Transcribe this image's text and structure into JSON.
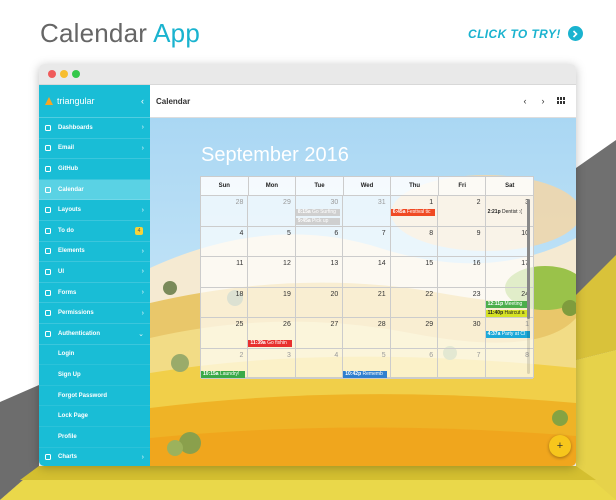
{
  "heading": {
    "part1": "Calendar",
    "part2": "App"
  },
  "cta": {
    "label": "CLICK TO TRY!"
  },
  "app": {
    "brand": "triangular",
    "toolbar_title": "Calendar"
  },
  "sidebar": {
    "items": [
      {
        "label": "Dashboards",
        "icon": "home-icon",
        "arrow": "›"
      },
      {
        "label": "Email",
        "icon": "mail-icon",
        "arrow": "›"
      },
      {
        "label": "GitHub",
        "icon": "github-icon",
        "arrow": ""
      },
      {
        "label": "Calendar",
        "icon": "calendar-icon",
        "arrow": "",
        "active": true
      },
      {
        "label": "Layouts",
        "icon": "layouts-icon",
        "arrow": "›"
      },
      {
        "label": "To do",
        "icon": "check-icon",
        "badge": "4"
      },
      {
        "label": "Elements",
        "icon": "elements-icon",
        "arrow": "›"
      },
      {
        "label": "UI",
        "icon": "ui-icon",
        "arrow": "›"
      },
      {
        "label": "Forms",
        "icon": "forms-icon",
        "arrow": "›"
      },
      {
        "label": "Permissions",
        "icon": "lock-icon",
        "arrow": "›"
      },
      {
        "label": "Authentication",
        "icon": "person-icon",
        "arrow": "⌄",
        "expanded": true
      },
      {
        "label": "Login",
        "sub": true
      },
      {
        "label": "Sign Up",
        "sub": true
      },
      {
        "label": "Forgot Password",
        "sub": true
      },
      {
        "label": "Lock Page",
        "sub": true
      },
      {
        "label": "Profile",
        "sub": true
      },
      {
        "label": "Charts",
        "icon": "chart-icon",
        "arrow": "›"
      }
    ]
  },
  "calendar": {
    "title": "September 2016",
    "weekdays": [
      "Sun",
      "Mon",
      "Tue",
      "Wed",
      "Thu",
      "Fri",
      "Sat"
    ],
    "days": [
      {
        "n": "28",
        "out": true
      },
      {
        "n": "29",
        "out": true
      },
      {
        "n": "30",
        "out": true
      },
      {
        "n": "31",
        "out": true
      },
      {
        "n": "1"
      },
      {
        "n": "2"
      },
      {
        "n": "3"
      },
      {
        "n": "4"
      },
      {
        "n": "5"
      },
      {
        "n": "6"
      },
      {
        "n": "7"
      },
      {
        "n": "8"
      },
      {
        "n": "9"
      },
      {
        "n": "10"
      },
      {
        "n": "11"
      },
      {
        "n": "12"
      },
      {
        "n": "13"
      },
      {
        "n": "14"
      },
      {
        "n": "15"
      },
      {
        "n": "16"
      },
      {
        "n": "17"
      },
      {
        "n": "18"
      },
      {
        "n": "19"
      },
      {
        "n": "20"
      },
      {
        "n": "21"
      },
      {
        "n": "22"
      },
      {
        "n": "23"
      },
      {
        "n": "24"
      },
      {
        "n": "25"
      },
      {
        "n": "26"
      },
      {
        "n": "27"
      },
      {
        "n": "28"
      },
      {
        "n": "29"
      },
      {
        "n": "30"
      },
      {
        "n": "1",
        "out": true
      },
      {
        "n": "2",
        "out": true
      },
      {
        "n": "3",
        "out": true
      },
      {
        "n": "4",
        "out": true
      },
      {
        "n": "5",
        "out": true
      },
      {
        "n": "6",
        "out": true
      },
      {
        "n": "7",
        "out": true
      },
      {
        "n": "8",
        "out": true
      }
    ],
    "events": [
      {
        "day": 2,
        "slot": 1,
        "time": "8:15a",
        "title": "Go Surfing",
        "color": "#cfcfcf"
      },
      {
        "day": 2,
        "slot": 2,
        "time": "9:45a",
        "title": "Pick up",
        "color": "#cfcfcf"
      },
      {
        "day": 4,
        "slot": 1,
        "time": "6:45a",
        "title": "Festival tic",
        "color": "#f04a24"
      },
      {
        "day": 6,
        "slot": 1,
        "time": "2:21p",
        "title": "Dentist :(",
        "color": "transparent",
        "dark": true
      },
      {
        "day": 27,
        "slot": 1,
        "time": "12:11p",
        "title": "Meeting",
        "color": "#4cae4c"
      },
      {
        "day": 27,
        "slot": 2,
        "time": "11:40p",
        "title": "Haircut a",
        "color": "#d6e224",
        "dark": true
      },
      {
        "day": 29,
        "slot": 2,
        "time": "11:39a",
        "title": "Go fishin",
        "color": "#e8312f"
      },
      {
        "day": 34,
        "slot": 1,
        "time": "4:37a",
        "title": "Party at Cl",
        "color": "#1ba8d8"
      },
      {
        "day": 35,
        "slot": 2,
        "time": "10:15a",
        "title": "Laundry!",
        "color": "#3aa948"
      },
      {
        "day": 38,
        "slot": 2,
        "time": "10:42p",
        "title": "Rememb",
        "color": "#2f7fcf"
      }
    ]
  },
  "fab": {
    "label": "+"
  }
}
